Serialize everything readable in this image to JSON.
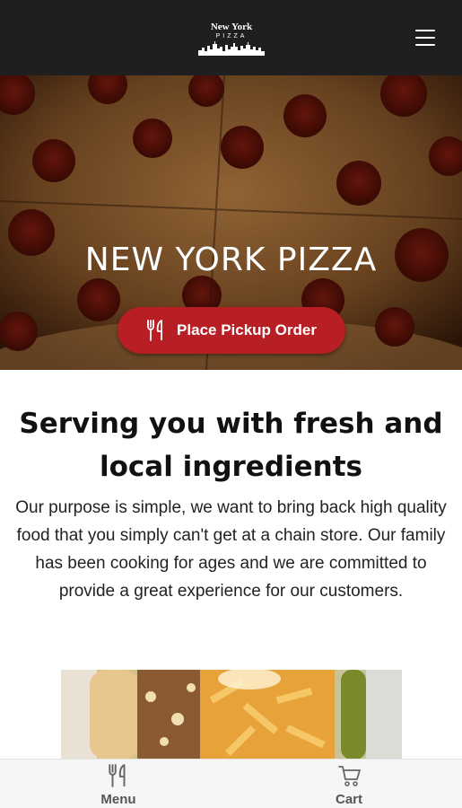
{
  "brand": {
    "line1": "New York",
    "line2": "PIZZA"
  },
  "hero": {
    "title": "NEW YORK PIZZA",
    "order_button": "Place Pickup Order",
    "order_icon": "fork-knife-icon"
  },
  "about": {
    "title": "Serving you with fresh and local ingredients",
    "body": "Our purpose is simple, we want to bring back high quality food that you simply can't get at a chain store. Our family has been cooking for ages and we are committed to provide a great experience for our customers."
  },
  "bottom_nav": [
    {
      "label": "Menu",
      "icon": "fork-knife-icon"
    },
    {
      "label": "Cart",
      "icon": "cart-icon"
    }
  ],
  "colors": {
    "header_bg": "#1f1f1f",
    "accent": "#b81f25",
    "nav_bg": "#f6f6f6",
    "nav_text": "#555555"
  }
}
